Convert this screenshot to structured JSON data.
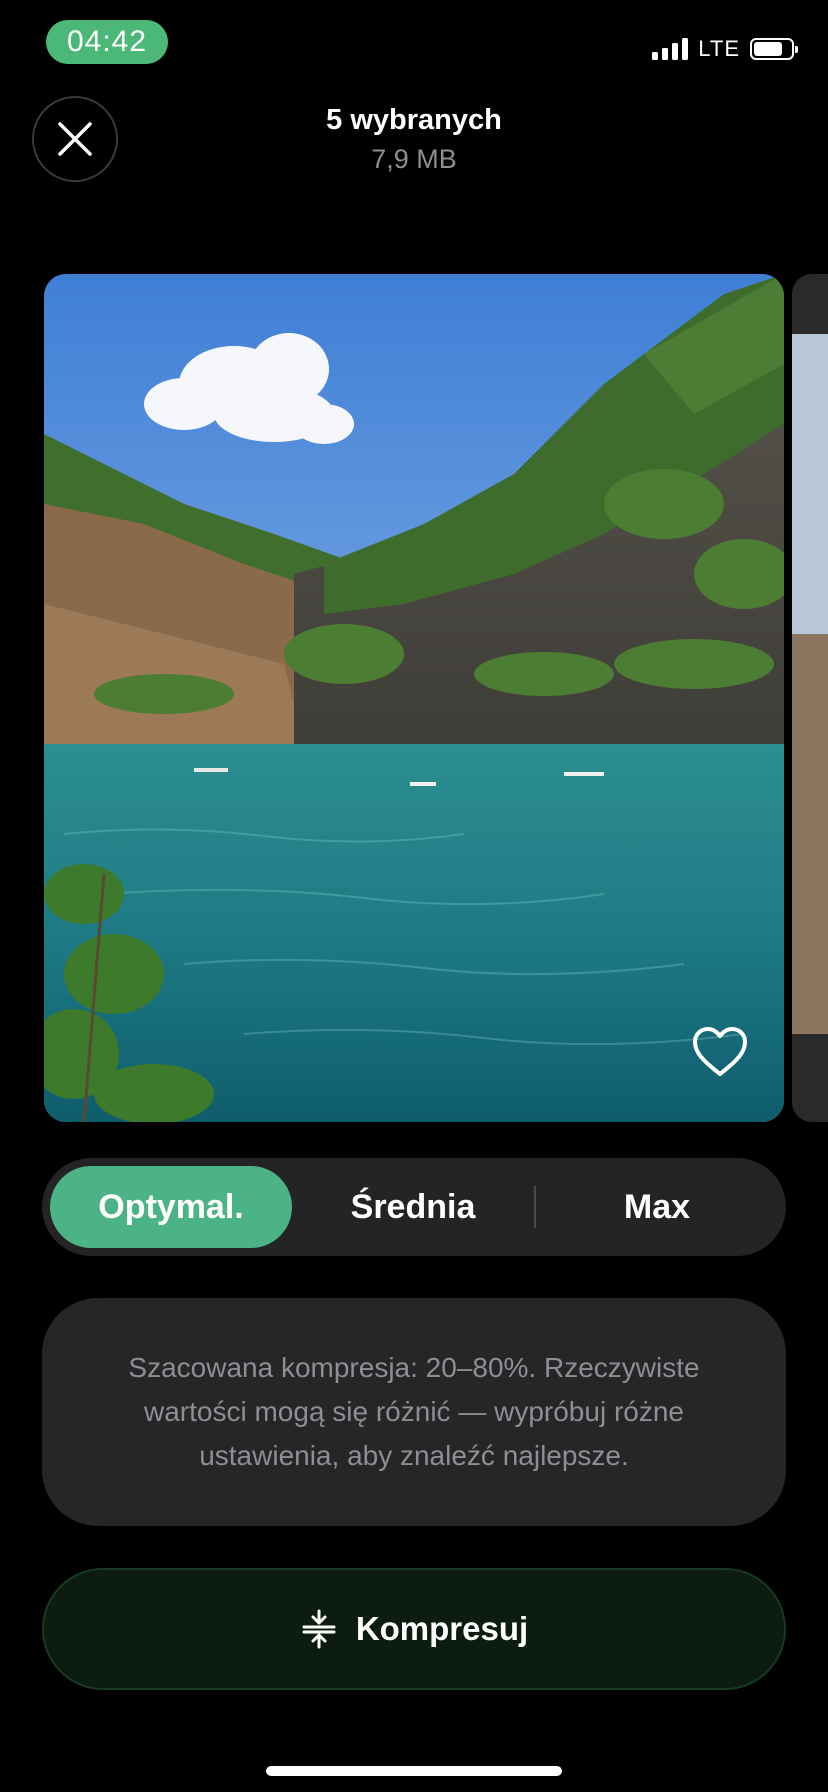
{
  "status_bar": {
    "time": "04:42",
    "network": "LTE",
    "signal_icon": "signal-bars-icon",
    "battery_icon": "battery-icon",
    "time_pill_color": "#4cb878"
  },
  "header": {
    "close_icon": "close-icon",
    "title": "5 wybranych",
    "subtitle": "7,9 MB"
  },
  "photo": {
    "favorite_icon": "heart-outline-icon"
  },
  "quality_options": {
    "items": [
      {
        "label": "Optymal.",
        "selected": true
      },
      {
        "label": "Średnia",
        "selected": false
      },
      {
        "label": "Max",
        "selected": false
      }
    ],
    "accent_color": "#4cb386"
  },
  "info": {
    "text": "Szacowana kompresja: 20–80%. Rzeczywiste wartości mogą się różnić — wypróbuj różne ustawienia, aby znaleźć najlepsze."
  },
  "compress": {
    "label": "Kompresuj",
    "icon": "compress-icon"
  }
}
